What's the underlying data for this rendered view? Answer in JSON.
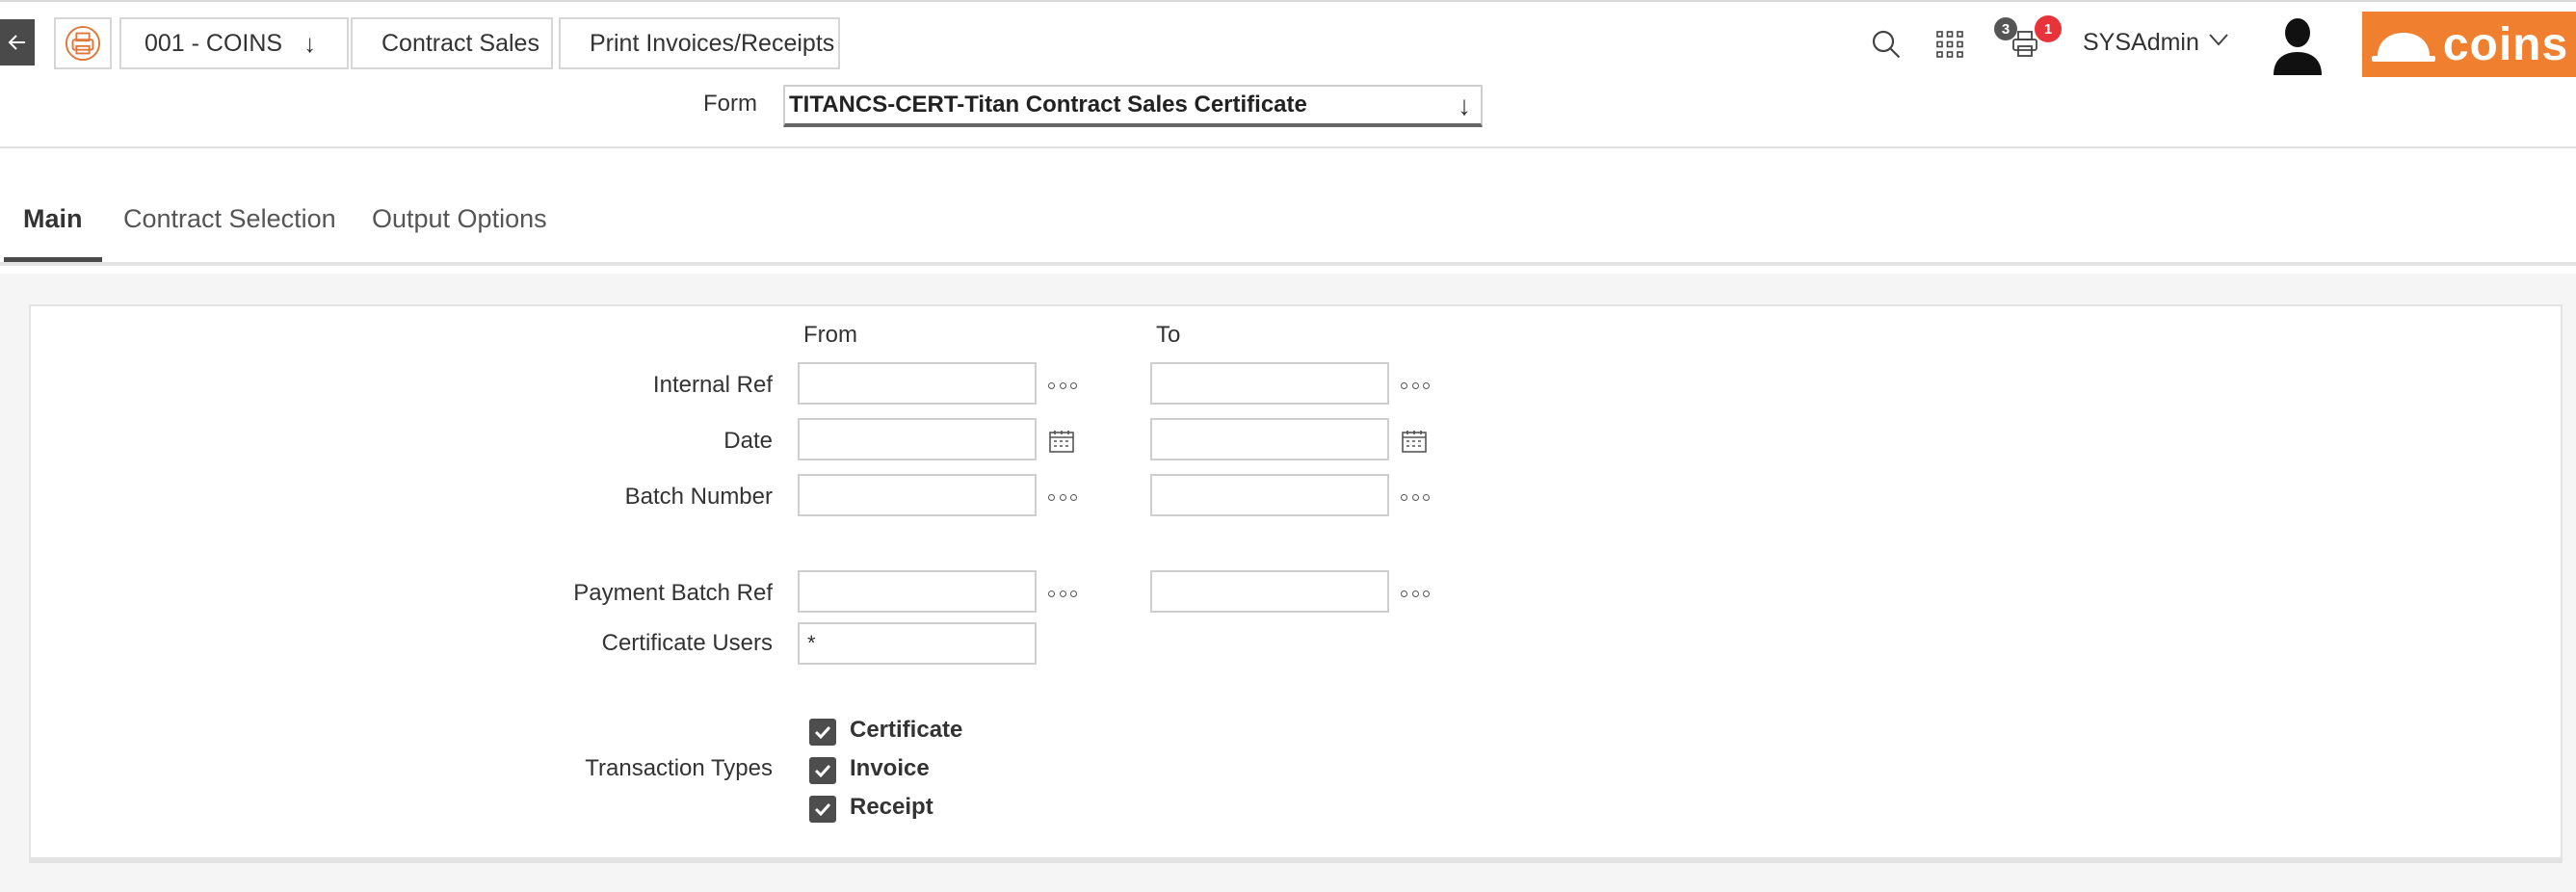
{
  "header": {
    "breadcrumbs": {
      "company": "001 - COINS",
      "module": "Contract Sales",
      "page": "Print Invoices/Receipts"
    },
    "notifications": {
      "queue_count": "3",
      "alert_count": "1"
    },
    "user": {
      "name": "SYSAdmin"
    },
    "logo_text": "coins",
    "colors": {
      "brand": "#f0802f",
      "badge_alert": "#e8333a",
      "back": "#4a4a4a"
    }
  },
  "form_selector": {
    "label": "Form",
    "value": "TITANCS-CERT-Titan Contract Sales Certificate"
  },
  "tabs": [
    {
      "label": "Main",
      "active": true
    },
    {
      "label": "Contract Selection",
      "active": false
    },
    {
      "label": "Output Options",
      "active": false
    }
  ],
  "main": {
    "columns": {
      "from": "From",
      "to": "To"
    },
    "fields": {
      "internal_ref": {
        "label": "Internal Ref",
        "from": "",
        "to": ""
      },
      "date": {
        "label": "Date",
        "from": "",
        "to": ""
      },
      "batch_number": {
        "label": "Batch Number",
        "from": "",
        "to": ""
      },
      "payment_batch_ref": {
        "label": "Payment Batch Ref",
        "from": "",
        "to": ""
      },
      "certificate_users": {
        "label": "Certificate Users",
        "value": "*"
      }
    },
    "transaction_types": {
      "label": "Transaction Types",
      "options": [
        {
          "label": "Certificate",
          "checked": true
        },
        {
          "label": "Invoice",
          "checked": true
        },
        {
          "label": "Receipt",
          "checked": true
        }
      ]
    }
  },
  "icons": {
    "back": "arrow-left-icon",
    "home": "printer-icon",
    "search": "search-icon",
    "apps": "grid-icon",
    "queue": "printer-queue-icon",
    "avatar": "user-silhouette-icon",
    "lookup": "ellipsis-icon",
    "calendar": "calendar-icon"
  }
}
